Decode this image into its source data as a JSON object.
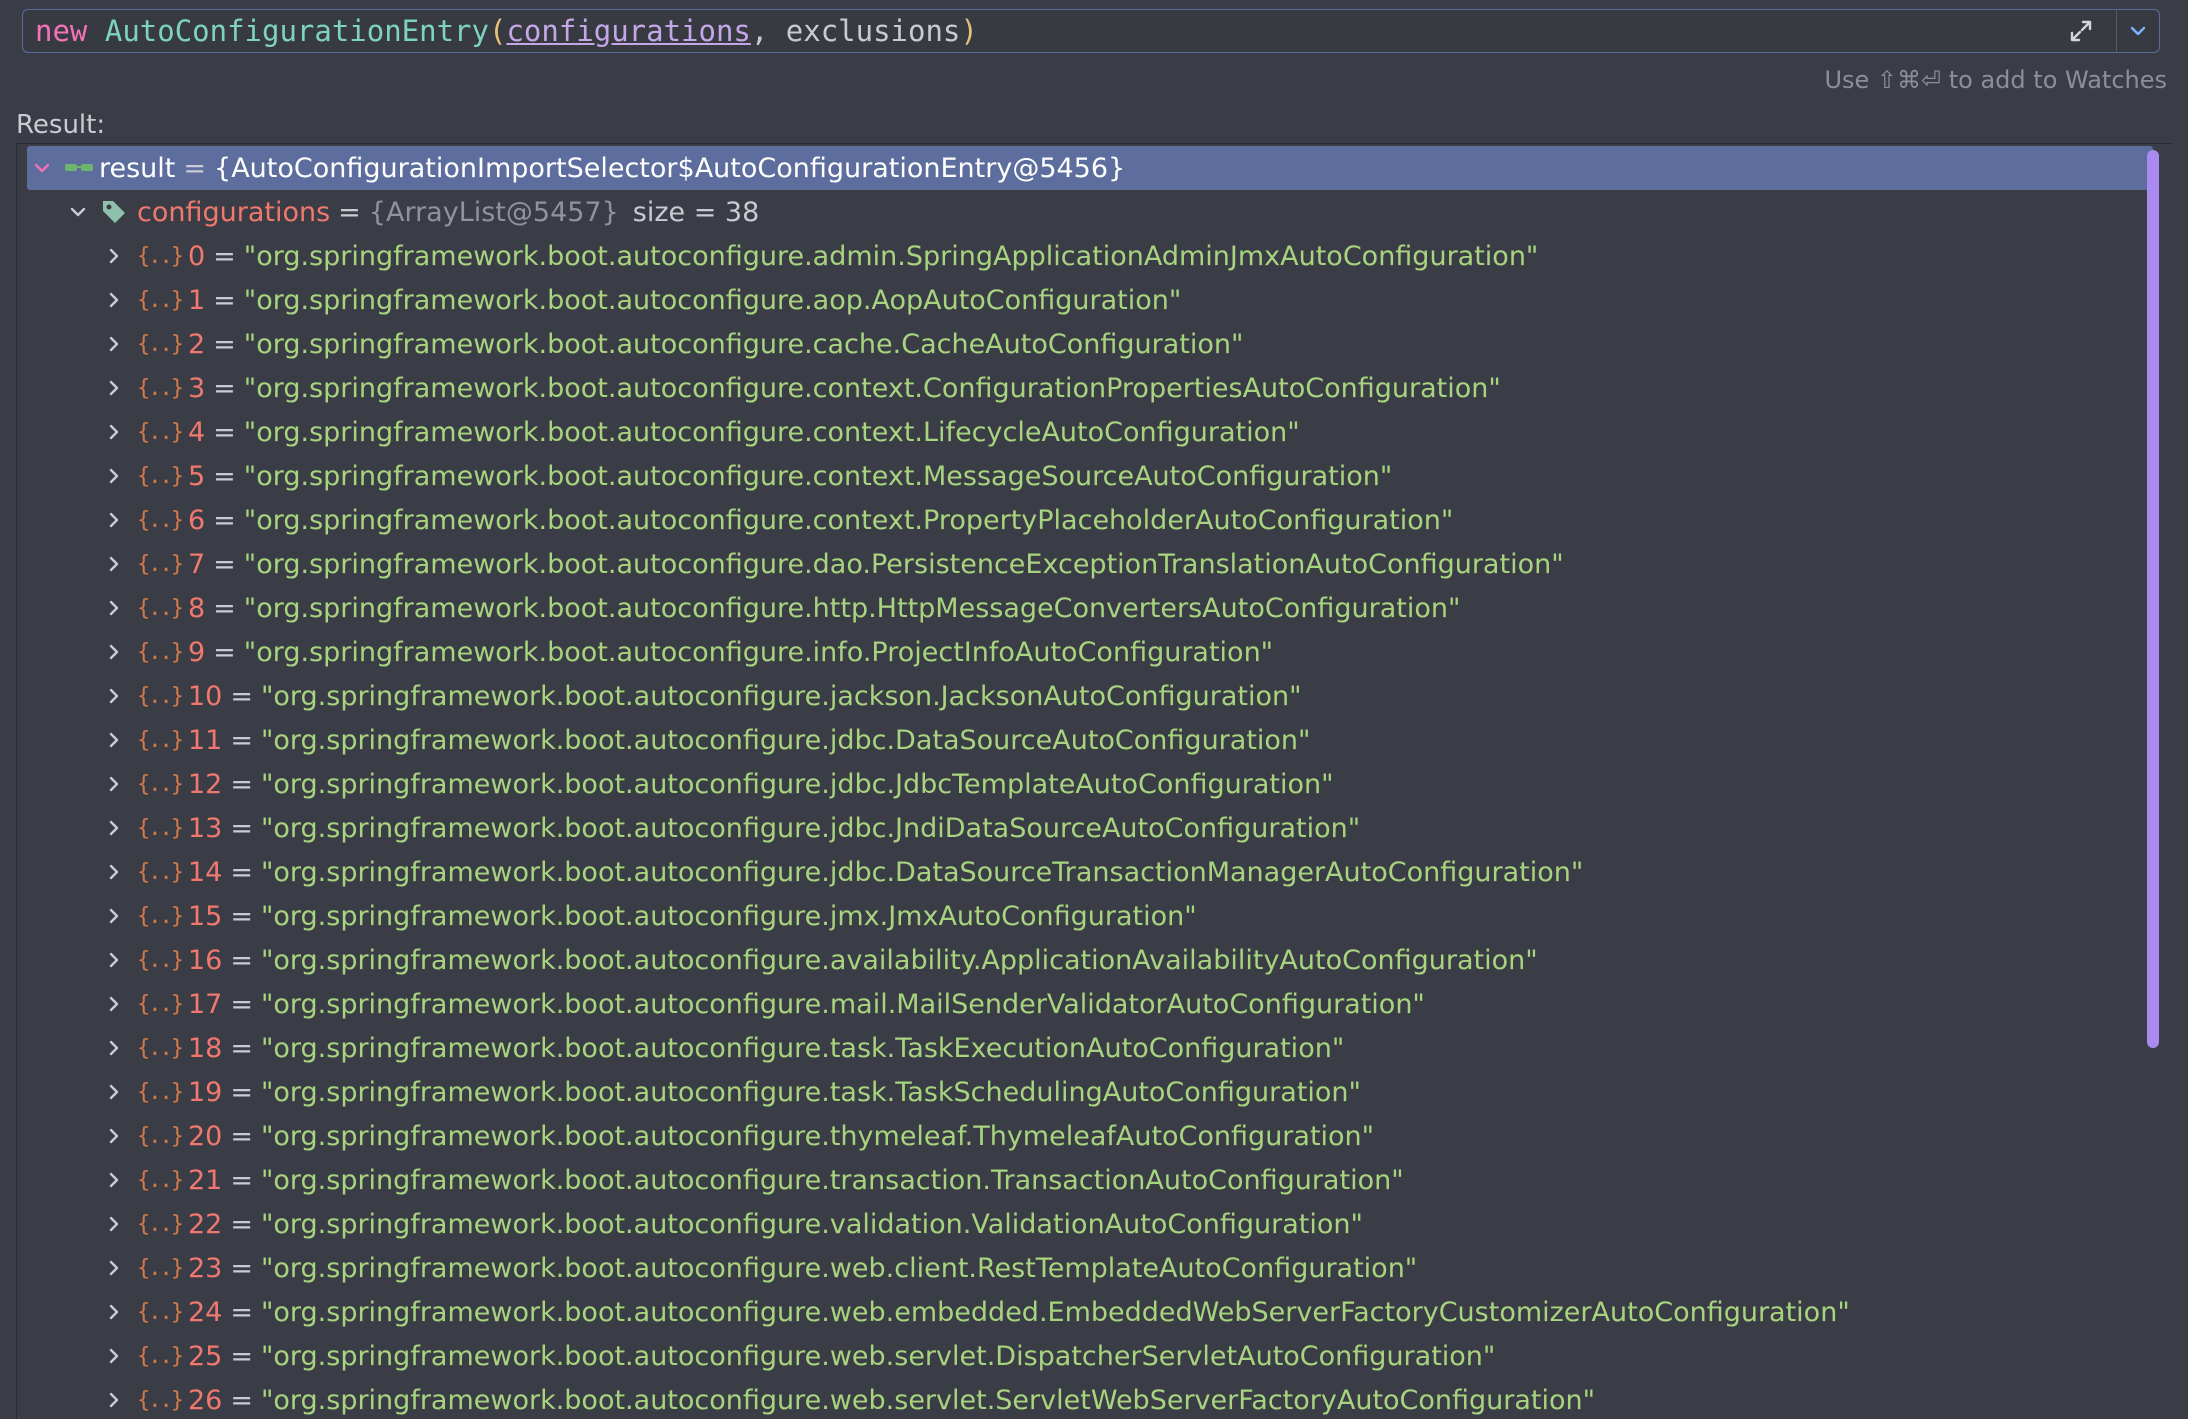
{
  "expression": {
    "keyword": "new",
    "class_name": "AutoConfigurationEntry",
    "open_paren": "(",
    "arg1": "configurations",
    "separator": ", ",
    "arg2": "exclusions",
    "close_paren": ")"
  },
  "hint": "Use ⇧⌘⏎ to add to Watches",
  "result_label": "Result:",
  "result_node": {
    "name": "result",
    "equals": "=",
    "value": "{AutoConfigurationImportSelector$AutoConfigurationEntry@5456}"
  },
  "configurations_node": {
    "name": "configurations",
    "equals": "=",
    "ref": "{ArrayList@5457}",
    "size": "size = 38"
  },
  "items": [
    {
      "index": "0",
      "value": "\"org.springframework.boot.autoconfigure.admin.SpringApplicationAdminJmxAutoConfiguration\""
    },
    {
      "index": "1",
      "value": "\"org.springframework.boot.autoconfigure.aop.AopAutoConfiguration\""
    },
    {
      "index": "2",
      "value": "\"org.springframework.boot.autoconfigure.cache.CacheAutoConfiguration\""
    },
    {
      "index": "3",
      "value": "\"org.springframework.boot.autoconfigure.context.ConfigurationPropertiesAutoConfiguration\""
    },
    {
      "index": "4",
      "value": "\"org.springframework.boot.autoconfigure.context.LifecycleAutoConfiguration\""
    },
    {
      "index": "5",
      "value": "\"org.springframework.boot.autoconfigure.context.MessageSourceAutoConfiguration\""
    },
    {
      "index": "6",
      "value": "\"org.springframework.boot.autoconfigure.context.PropertyPlaceholderAutoConfiguration\""
    },
    {
      "index": "7",
      "value": "\"org.springframework.boot.autoconfigure.dao.PersistenceExceptionTranslationAutoConfiguration\""
    },
    {
      "index": "8",
      "value": "\"org.springframework.boot.autoconfigure.http.HttpMessageConvertersAutoConfiguration\""
    },
    {
      "index": "9",
      "value": "\"org.springframework.boot.autoconfigure.info.ProjectInfoAutoConfiguration\""
    },
    {
      "index": "10",
      "value": "\"org.springframework.boot.autoconfigure.jackson.JacksonAutoConfiguration\""
    },
    {
      "index": "11",
      "value": "\"org.springframework.boot.autoconfigure.jdbc.DataSourceAutoConfiguration\""
    },
    {
      "index": "12",
      "value": "\"org.springframework.boot.autoconfigure.jdbc.JdbcTemplateAutoConfiguration\""
    },
    {
      "index": "13",
      "value": "\"org.springframework.boot.autoconfigure.jdbc.JndiDataSourceAutoConfiguration\""
    },
    {
      "index": "14",
      "value": "\"org.springframework.boot.autoconfigure.jdbc.DataSourceTransactionManagerAutoConfiguration\""
    },
    {
      "index": "15",
      "value": "\"org.springframework.boot.autoconfigure.jmx.JmxAutoConfiguration\""
    },
    {
      "index": "16",
      "value": "\"org.springframework.boot.autoconfigure.availability.ApplicationAvailabilityAutoConfiguration\""
    },
    {
      "index": "17",
      "value": "\"org.springframework.boot.autoconfigure.mail.MailSenderValidatorAutoConfiguration\""
    },
    {
      "index": "18",
      "value": "\"org.springframework.boot.autoconfigure.task.TaskExecutionAutoConfiguration\""
    },
    {
      "index": "19",
      "value": "\"org.springframework.boot.autoconfigure.task.TaskSchedulingAutoConfiguration\""
    },
    {
      "index": "20",
      "value": "\"org.springframework.boot.autoconfigure.thymeleaf.ThymeleafAutoConfiguration\""
    },
    {
      "index": "21",
      "value": "\"org.springframework.boot.autoconfigure.transaction.TransactionAutoConfiguration\""
    },
    {
      "index": "22",
      "value": "\"org.springframework.boot.autoconfigure.validation.ValidationAutoConfiguration\""
    },
    {
      "index": "23",
      "value": "\"org.springframework.boot.autoconfigure.web.client.RestTemplateAutoConfiguration\""
    },
    {
      "index": "24",
      "value": "\"org.springframework.boot.autoconfigure.web.embedded.EmbeddedWebServerFactoryCustomizerAutoConfiguration\""
    },
    {
      "index": "25",
      "value": "\"org.springframework.boot.autoconfigure.web.servlet.DispatcherServletAutoConfiguration\""
    },
    {
      "index": "26",
      "value": "\"org.springframework.boot.autoconfigure.web.servlet.ServletWebServerFactoryAutoConfiguration\""
    }
  ],
  "icons": {
    "expand": "expand-arrows-icon",
    "history": "chevron-down-icon",
    "result": "watch-glasses-icon",
    "field": "field-tag-icon",
    "array_item": "array-braces-icon"
  },
  "colors": {
    "background": "#3b3d46",
    "selection": "#5d6e9e",
    "string": "#a8d47f",
    "field_name": "#f0786e",
    "keyword": "#f472b6",
    "class": "#7dd3c0",
    "scrollbar": "#a98af0"
  }
}
